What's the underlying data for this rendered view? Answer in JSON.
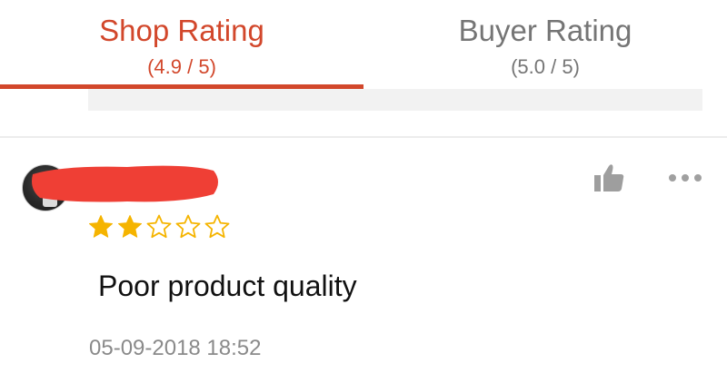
{
  "tabs": [
    {
      "label": "Shop Rating",
      "score": "(4.9 / 5)",
      "active": true
    },
    {
      "label": "Buyer Rating",
      "score": "(5.0 / 5)",
      "active": false
    }
  ],
  "review": {
    "rating": 2,
    "max_rating": 5,
    "text": "Poor product quality",
    "timestamp": "05-09-2018 18:52",
    "icons": [
      "avatar",
      "thumbs-up-icon",
      "more-options-icon",
      "star-icon"
    ]
  },
  "colors": {
    "accent": "#d2472b",
    "star_filled": "#f5b400",
    "star_outline": "#f5b400",
    "redaction": "#ef3f35",
    "tab_inactive": "#757575",
    "timestamp": "#8a8a8a"
  }
}
